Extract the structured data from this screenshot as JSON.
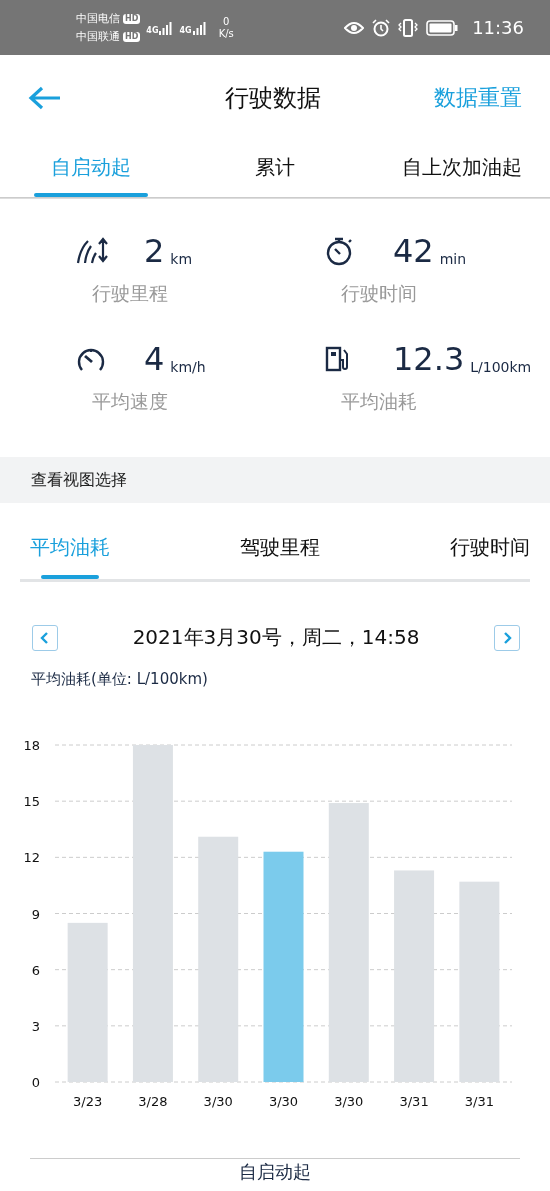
{
  "status_bar": {
    "carriers": [
      {
        "name": "中国电信",
        "badge": "HD",
        "network": "4G"
      },
      {
        "name": "中国联通",
        "badge": "HD",
        "network": "4G"
      }
    ],
    "speed_value": "0",
    "speed_unit": "K/s",
    "time": "11:36"
  },
  "header": {
    "title": "行驶数据",
    "action": "数据重置"
  },
  "tabs": [
    {
      "label": "自启动起",
      "selected": true
    },
    {
      "label": "累计",
      "selected": false
    },
    {
      "label": "自上次加油起",
      "selected": false
    }
  ],
  "stats": [
    {
      "kind": "distance",
      "value": "2",
      "unit": "km",
      "label": "行驶里程"
    },
    {
      "kind": "time",
      "value": "42",
      "unit": "min",
      "label": "行驶时间"
    },
    {
      "kind": "speed",
      "value": "4",
      "unit": "km/h",
      "label": "平均速度"
    },
    {
      "kind": "fuel",
      "value": "12.3",
      "unit": "L/100km",
      "label": "平均油耗"
    }
  ],
  "section_title": "查看视图选择",
  "view_tabs": [
    {
      "label": "平均油耗",
      "selected": true
    },
    {
      "label": "驾驶里程",
      "selected": false
    },
    {
      "label": "行驶时间",
      "selected": false
    }
  ],
  "date_nav": {
    "date": "2021年3月30号，周二，14:58"
  },
  "chart_panel": {
    "subtitle": "平均油耗(单位: L/100km)",
    "bars": [
      {
        "color": "#dde1e5"
      },
      {
        "color": "#dde1e5"
      },
      {
        "color": "#dde1e5"
      },
      {
        "color": "#7bcbec"
      },
      {
        "color": "#dde1e5"
      },
      {
        "color": "#dde1e5"
      },
      {
        "color": "#dde1e5"
      }
    ],
    "chart_data": {
      "type": "bar",
      "categories": [
        "3/23",
        "3/28",
        "3/30",
        "3/30",
        "3/30",
        "3/31",
        "3/31"
      ],
      "series": [
        {
          "values": [
            8.5,
            18,
            13.1,
            12.3,
            14.9,
            11.3,
            10.7
          ]
        }
      ],
      "ylim": [
        0,
        18
      ],
      "yticks": [
        0,
        3,
        6,
        9,
        12,
        15,
        18
      ],
      "grid": true
    }
  },
  "footer_label": "自启动起"
}
